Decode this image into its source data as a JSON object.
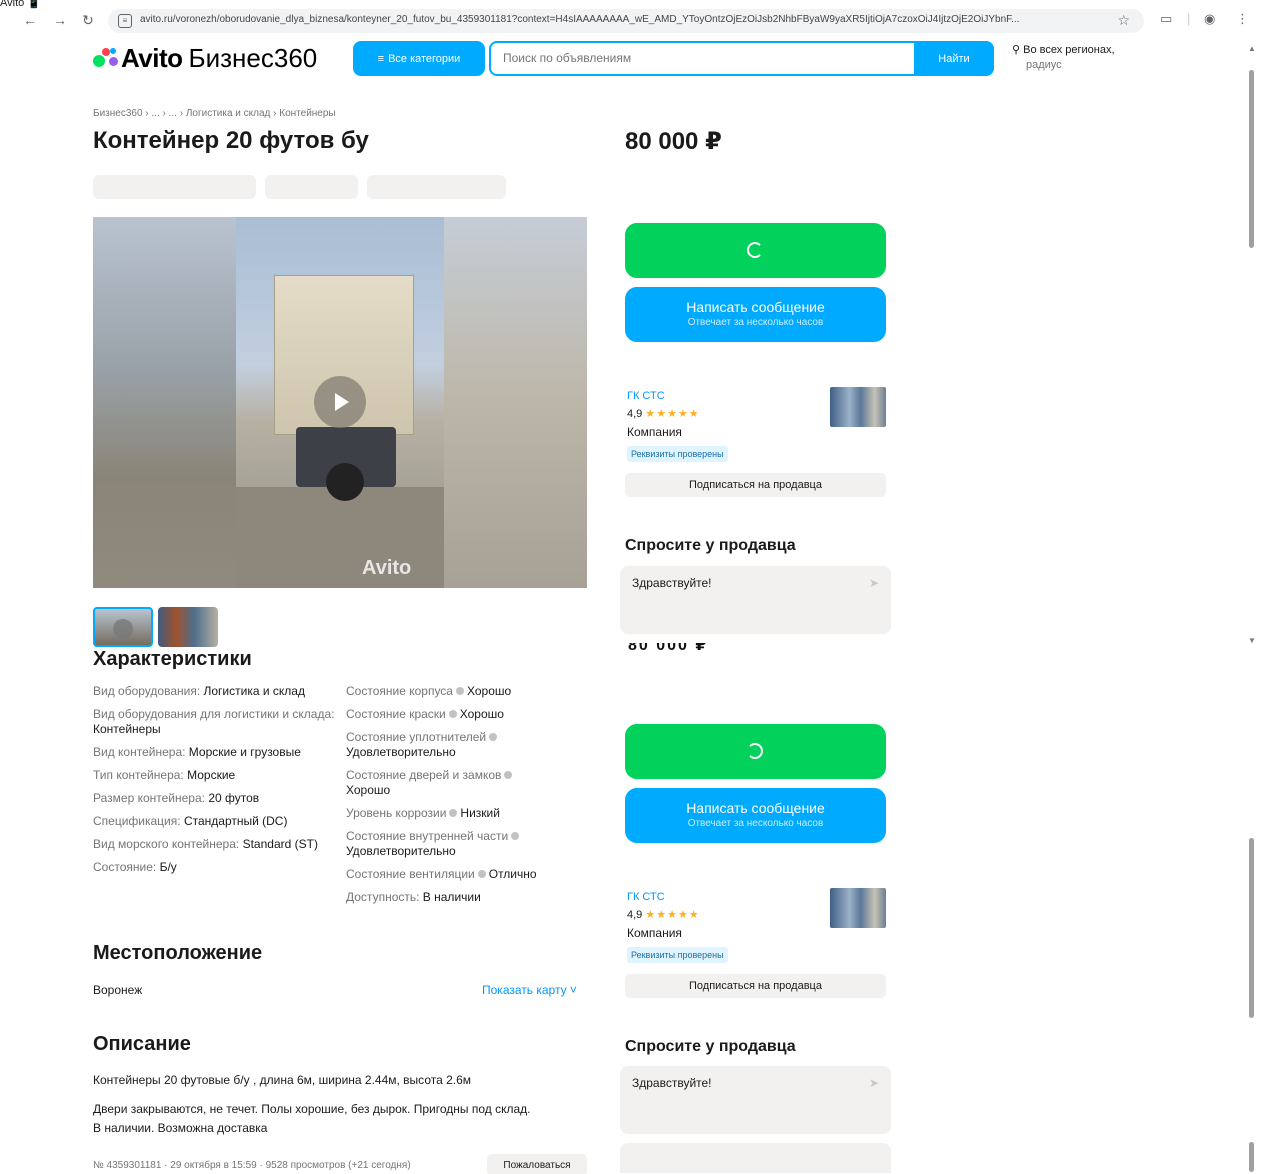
{
  "browser": {
    "tab_label": "Avito 📱",
    "url": "avito.ru/voronezh/oborudovanie_dlya_biznesa/konteyner_20_futov_bu_4359301181?context=H4sIAAAAAAAA_wE_AMD_YToyOntzOjEzOiJsb2NhbFByaW9yaXR5IjtiOjA7czoxOiJ4IjtzOjE2OiJYbnF..."
  },
  "header": {
    "logo_avito": "Avito",
    "logo_b360": "Бизнес360",
    "categories_label": "Все категории",
    "search_placeholder": "Поиск по объявлениям",
    "search_button": "Найти",
    "region_line1": "Во всех регионах,",
    "region_line2": "радиус"
  },
  "breadcrumb": "Бизнес360 › ... › ... › Логистика и склад › Контейнеры",
  "title": "Контейнер 20 футов бу",
  "price": "80 000 ₽",
  "gallery": {
    "watermark": "Avito"
  },
  "specs": {
    "section_title": "Характеристики",
    "left": [
      {
        "label": "Вид оборудования:",
        "value": "Логистика и склад"
      },
      {
        "label": "Вид оборудования для логистики и склада:",
        "value": "Контейнеры"
      },
      {
        "label": "Вид контейнера:",
        "value": "Морские и грузовые"
      },
      {
        "label": "Тип контейнера:",
        "value": "Морские"
      },
      {
        "label": "Размер контейнера:",
        "value": "20 футов"
      },
      {
        "label": "Спецификация:",
        "value": "Стандартный (DC)"
      },
      {
        "label": "Вид морского контейнера:",
        "value": "Standard (ST)"
      },
      {
        "label": "Состояние:",
        "value": "Б/у"
      }
    ],
    "right": [
      {
        "label": "Состояние корпуса",
        "value": "Хорошо"
      },
      {
        "label": "Состояние краски",
        "value": "Хорошо"
      },
      {
        "label": "Состояние уплотнителей",
        "value": "Удовлетворительно"
      },
      {
        "label": "Состояние дверей и замков",
        "value": "Хорошо"
      },
      {
        "label": "Уровень коррозии",
        "value": "Низкий"
      },
      {
        "label": "Состояние внутренней части",
        "value": "Удовлетворительно"
      },
      {
        "label": "Состояние вентиляции",
        "value": "Отлично"
      },
      {
        "label": "Доступность:",
        "value": "В наличии"
      }
    ]
  },
  "location": {
    "section_title": "Местоположение",
    "city": "Воронеж",
    "map_link": "Показать карту ˅"
  },
  "description": {
    "section_title": "Описание",
    "line1": "Контейнеры 20 футовые б/у , длина 6м, ширина 2.44м, высота 2.6м",
    "line2": "Двери закрываются, не течет. Полы хорошие, без дырок. Пригодны под склад.",
    "line3": "В наличии. Возможна доставка"
  },
  "footer": {
    "meta": "№ 4359301181 · 29 октября в 15:59 · 9528 просмотров (+21 сегодня)",
    "report_button": "Пожаловаться"
  },
  "seller": {
    "message_button": "Написать сообщение",
    "message_sub": "Отвечает за несколько часов",
    "name": "ГК СТС",
    "rating": "4,9",
    "stars": "★★★★★",
    "type": "Компания",
    "verified": "Реквизиты проверены",
    "subscribe": "Подписаться на продавца"
  },
  "ask": {
    "title": "Спросите у продавца",
    "text": "Здравствуйте!"
  },
  "colors": {
    "accent_blue": "#00aaff",
    "green": "#02d15c",
    "link": "#0099f7"
  }
}
